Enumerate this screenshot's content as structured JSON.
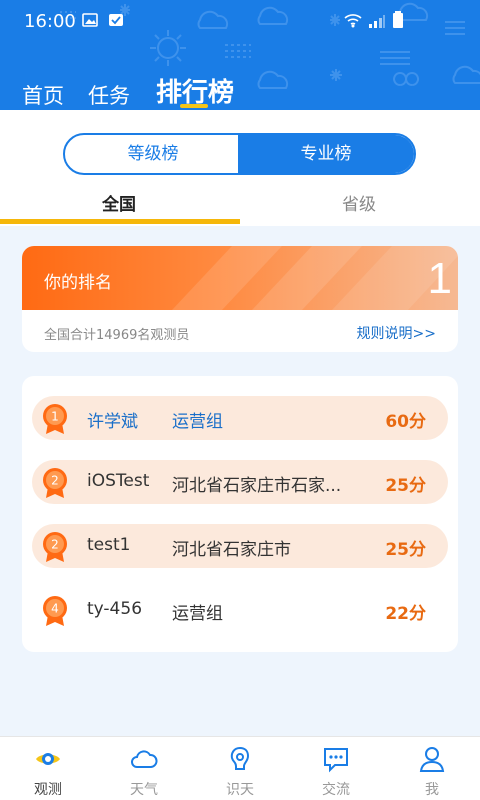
{
  "status_bar": {
    "time": "16:00"
  },
  "nav": {
    "tabs": [
      "首页",
      "任务",
      "排行榜"
    ],
    "active_index": 2
  },
  "segment": {
    "left": "等级榜",
    "right": "专业榜",
    "active": "专业榜"
  },
  "subtabs": {
    "national": "全国",
    "provincial": "省级",
    "active": "全国"
  },
  "my_rank": {
    "label": "你的排名",
    "value": "1",
    "total_text": "全国合计14969名观测员",
    "rules_link": "规则说明>>"
  },
  "ranking": [
    {
      "rank": "1",
      "name": "许学斌",
      "group": "运营组",
      "score": "60分",
      "highlight": true,
      "name_blue": true
    },
    {
      "rank": "2",
      "name": "iOSTest",
      "group": "河北省石家庄市石家...",
      "score": "25分",
      "highlight": true,
      "name_blue": false
    },
    {
      "rank": "2",
      "name": "test1",
      "group": "河北省石家庄市",
      "score": "25分",
      "highlight": true,
      "name_blue": false
    },
    {
      "rank": "4",
      "name": "ty-456",
      "group": "运营组",
      "score": "22分",
      "highlight": false,
      "name_blue": false
    }
  ],
  "bottom_nav": [
    {
      "label": "观测",
      "icon": "eye-icon",
      "active": true
    },
    {
      "label": "天气",
      "icon": "cloud-icon",
      "active": false
    },
    {
      "label": "识天",
      "icon": "recognize-icon",
      "active": false
    },
    {
      "label": "交流",
      "icon": "chat-icon",
      "active": false
    },
    {
      "label": "我",
      "icon": "user-icon",
      "active": false
    }
  ],
  "colors": {
    "primary": "#1a7de6",
    "accent_orange": "#ff6a13",
    "score": "#e86a12",
    "indicator": "#f5b70a"
  }
}
